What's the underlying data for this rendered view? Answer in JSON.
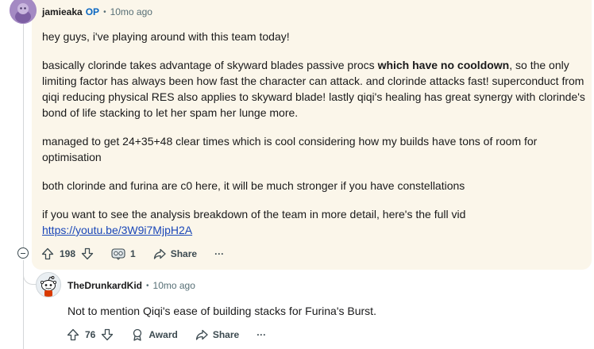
{
  "op_comment": {
    "author": "jamieaka",
    "op_badge": "OP",
    "time": "10mo ago",
    "paragraphs": {
      "p1": "hey guys, i've playing around with this team today!",
      "p2_before": "basically clorinde takes advantage of skyward blades passive procs ",
      "p2_bold": "which have no cooldown",
      "p2_after": ", so the only limiting factor has always been how fast the character can attack. and clorinde attacks fast! superconduct from qiqi reducing physical RES also applies to skyward blade! lastly qiqi's healing has great synergy with clorinde's bond of life stacking to let her spam her lunge more.",
      "p3": "managed to get 24+35+48 clear times which is cool considering how my builds have tons of room for optimisation",
      "p4": "both clorinde and furina are c0 here, it will be much stronger if you have constellations",
      "p5_text": "if you want to see the analysis breakdown of the team in more detail, here's the full vid ",
      "p5_link": "https://youtu.be/3W9i7MjpH2A"
    },
    "actions": {
      "votes": "198",
      "awards": "1",
      "share_label": "Share",
      "more": "···"
    }
  },
  "reply": {
    "author": "TheDrunkardKid",
    "time": "10mo ago",
    "text": "Not to mention Qiqi's ease of building stacks for Furina's Burst.",
    "actions": {
      "votes": "76",
      "award_label": "Award",
      "share_label": "Share",
      "more": "···"
    }
  },
  "colors": {
    "highlight_bg": "#fbf6ea",
    "op_badge": "#0a66c2",
    "link": "#1a47b8",
    "meta": "#576f76"
  },
  "icons": [
    "upvote-icon",
    "downvote-icon",
    "award-icon",
    "share-icon",
    "more-icon",
    "collapse-icon",
    "avatar"
  ]
}
